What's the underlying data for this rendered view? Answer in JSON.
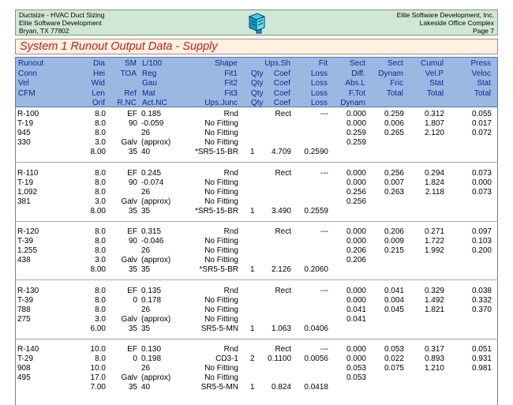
{
  "header": {
    "left_lines": [
      "Ductsize - HVAC Duct Sizing",
      "Elite Software Development",
      "Bryan, TX 77802"
    ],
    "right_lines": [
      "Elite Software Development, Inc.",
      "Lakeside Office Complex",
      "Page 7"
    ],
    "logo_icon": "duct-fitting-icon"
  },
  "report_title": "System 1 Runout Output Data - Supply",
  "columns": [
    {
      "key": "c1",
      "align": "left",
      "lines": [
        "Runout",
        "Conn",
        "Vel",
        "CFM",
        ""
      ]
    },
    {
      "key": "c2",
      "align": "right",
      "lines": [
        "Dia",
        "Hei",
        "Wid",
        "Len",
        "Orif"
      ]
    },
    {
      "key": "c3",
      "align": "right",
      "lines": [
        "SM",
        "TOA",
        "",
        "Ref",
        "R.NC"
      ]
    },
    {
      "key": "c4",
      "align": "left",
      "lines": [
        "L/100",
        "Reg",
        "Gau",
        "Mat",
        "Act.NC"
      ]
    },
    {
      "key": "c5",
      "align": "right",
      "lines": [
        "Shape",
        "Fit1",
        "Fit2",
        "Fit3",
        "Ups.Junc"
      ]
    },
    {
      "key": "c6",
      "align": "left",
      "lines": [
        "",
        "Qty",
        "Qty",
        "Qty",
        "Qty"
      ]
    },
    {
      "key": "c7",
      "align": "right",
      "lines": [
        "Ups.Sh",
        "Coef",
        "Coef",
        "Coef",
        "Coef"
      ]
    },
    {
      "key": "c8",
      "align": "right",
      "lines": [
        "Fit",
        "Loss",
        "Loss",
        "Loss",
        "Loss"
      ]
    },
    {
      "key": "c9",
      "align": "right",
      "lines": [
        "Sect",
        "Diff.",
        "Abs.L",
        "F.Tot",
        "Dynam"
      ]
    },
    {
      "key": "c10",
      "align": "right",
      "lines": [
        "Sect",
        "Dynam",
        "Fric",
        "Total",
        ""
      ]
    },
    {
      "key": "c11",
      "align": "right",
      "lines": [
        "Cumul",
        "Vel.P",
        "Stat",
        "Total",
        ""
      ]
    },
    {
      "key": "c12",
      "align": "right",
      "lines": [
        "Press",
        "Veloc",
        "Stat",
        "Total",
        ""
      ]
    }
  ],
  "runouts": [
    {
      "lines": [
        [
          "R-100",
          "8.0",
          "EF",
          "0.185",
          "Rnd",
          "",
          "Rect",
          "---",
          "0.000",
          "0.259",
          "0.312",
          "0.055"
        ],
        [
          "T-19",
          "8.0",
          "90",
          "-0.059",
          "No Fitting",
          "",
          "",
          "",
          "0.000",
          "0.006",
          "1.807",
          "0.017"
        ],
        [
          "945",
          "8.0",
          "",
          "26",
          "No Fitting",
          "",
          "",
          "",
          "0.259",
          "0.265",
          "2.120",
          "0.072"
        ],
        [
          "330",
          "3.0",
          "Galv",
          "(approx)",
          "No Fitting",
          "",
          "",
          "",
          "0.259",
          "",
          "",
          ""
        ],
        [
          "",
          "8.00",
          "35",
          "40",
          "*SR5-15-BR",
          "1",
          "4.709",
          "0.2590",
          "",
          "",
          "",
          ""
        ]
      ]
    },
    {
      "lines": [
        [
          "R-110",
          "8.0",
          "EF",
          "0.245",
          "Rnd",
          "",
          "Rect",
          "---",
          "0.000",
          "0.256",
          "0.294",
          "0.073"
        ],
        [
          "T-19",
          "8.0",
          "90",
          "-0.074",
          "No Fitting",
          "",
          "",
          "",
          "0.000",
          "0.007",
          "1.824",
          "0.000"
        ],
        [
          "1,092",
          "8.0",
          "",
          "26",
          "No Fitting",
          "",
          "",
          "",
          "0.256",
          "0.263",
          "2.118",
          "0.073"
        ],
        [
          "381",
          "3.0",
          "Galv",
          "(approx)",
          "No Fitting",
          "",
          "",
          "",
          "0.256",
          "",
          "",
          ""
        ],
        [
          "",
          "8.00",
          "35",
          "35",
          "*SR5-15-BR",
          "1",
          "3.490",
          "0.2559",
          "",
          "",
          "",
          ""
        ]
      ]
    },
    {
      "lines": [
        [
          "R-120",
          "8.0",
          "EF",
          "0.315",
          "Rnd",
          "",
          "Rect",
          "---",
          "0.000",
          "0.206",
          "0.271",
          "0.097"
        ],
        [
          "T-39",
          "8.0",
          "90",
          "-0.046",
          "No Fitting",
          "",
          "",
          "",
          "0.000",
          "0.009",
          "1.722",
          "0.103"
        ],
        [
          "1,255",
          "8.0",
          "",
          "26",
          "No Fitting",
          "",
          "",
          "",
          "0.206",
          "0.215",
          "1.992",
          "0.200"
        ],
        [
          "438",
          "3.0",
          "Galv",
          "(approx)",
          "No Fitting",
          "",
          "",
          "",
          "0.206",
          "",
          "",
          ""
        ],
        [
          "",
          "8.00",
          "35",
          "35",
          "*SR5-5-BR",
          "1",
          "2.126",
          "0.2060",
          "",
          "",
          "",
          ""
        ]
      ]
    },
    {
      "lines": [
        [
          "R-130",
          "8.0",
          "EF",
          "0.135",
          "Rnd",
          "",
          "Rect",
          "---",
          "0.000",
          "0.041",
          "0.329",
          "0.038"
        ],
        [
          "T-39",
          "8.0",
          "0",
          "0.178",
          "No Fitting",
          "",
          "",
          "",
          "0.000",
          "0.004",
          "1.492",
          "0.332"
        ],
        [
          "788",
          "8.0",
          "",
          "26",
          "No Fitting",
          "",
          "",
          "",
          "0.041",
          "0.045",
          "1.821",
          "0.370"
        ],
        [
          "275",
          "3.0",
          "Galv",
          "(approx)",
          "No Fitting",
          "",
          "",
          "",
          "0.041",
          "",
          "",
          ""
        ],
        [
          "",
          "6.00",
          "35",
          "35",
          "SR5-5-MN",
          "1",
          "1.063",
          "0.0406",
          "",
          "",
          "",
          ""
        ]
      ]
    },
    {
      "lines": [
        [
          "R-140",
          "10.0",
          "EF",
          "0.130",
          "Rnd",
          "",
          "Rect",
          "---",
          "0.000",
          "0.053",
          "0.317",
          "0.051"
        ],
        [
          "T-29",
          "8.0",
          "0",
          "0.198",
          "CD3-1",
          "2",
          "0.1100",
          "0.0056",
          "0.000",
          "0.022",
          "0.893",
          "0.931"
        ],
        [
          "908",
          "10.0",
          "",
          "26",
          "No Fitting",
          "",
          "",
          "",
          "0.053",
          "0.075",
          "1.210",
          "0.981"
        ],
        [
          "495",
          "17.0",
          "Galv",
          "(approx)",
          "No Fitting",
          "",
          "",
          "",
          "0.053",
          "",
          "",
          ""
        ],
        [
          "",
          "7.00",
          "35",
          "40",
          "SR5-5-MN",
          "1",
          "0.824",
          "0.0418",
          "",
          "",
          "",
          ""
        ]
      ]
    }
  ]
}
